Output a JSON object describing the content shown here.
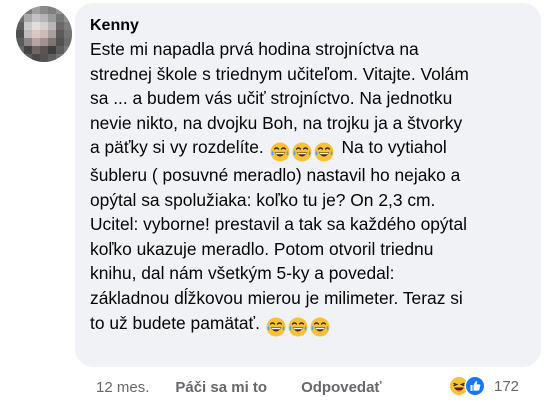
{
  "comment": {
    "author": "Kenny",
    "lines": [
      "Este mi napadla prvá hodina strojníctva na",
      "strednej škole s triednym učiteľom. Vitajte. Volám",
      "sa ... a budem vás učiť strojníctvo. Na jednotku",
      "nevie nikto, na dvojku Boh, na trojku ja a štvorky",
      "a päťky si vy rozdelíte.",
      "Na to vytiahol",
      "šubleru ( posuvné meradlo) nastavil ho nejako a",
      "opýtal sa spolužiaka: koľko tu je? On 2,3 cm.",
      "Ucitel: vyborne! prestavil a tak sa každého opýtal",
      "koľko ukazuje meradlo.  Potom otvoril triednu",
      "knihu, dal nám všetkým 5-ky a povedal:",
      "základnou dĺžkovou mierou je milimeter. Teraz si",
      "to už budete pamätať."
    ],
    "emoji_name": "laughing-tears-emoji",
    "colors": {
      "bubble": "#f0f2f5",
      "secondary_text": "#65676b",
      "like_blue": "#1877f2",
      "emoji_yellow": "#f7c23a"
    }
  },
  "actions": {
    "time": "12 mes.",
    "like": "Páči sa mi to",
    "reply": "Odpovedať"
  },
  "reactions": {
    "icons": [
      "haha-reaction-icon",
      "like-reaction-icon"
    ],
    "count": "172"
  }
}
